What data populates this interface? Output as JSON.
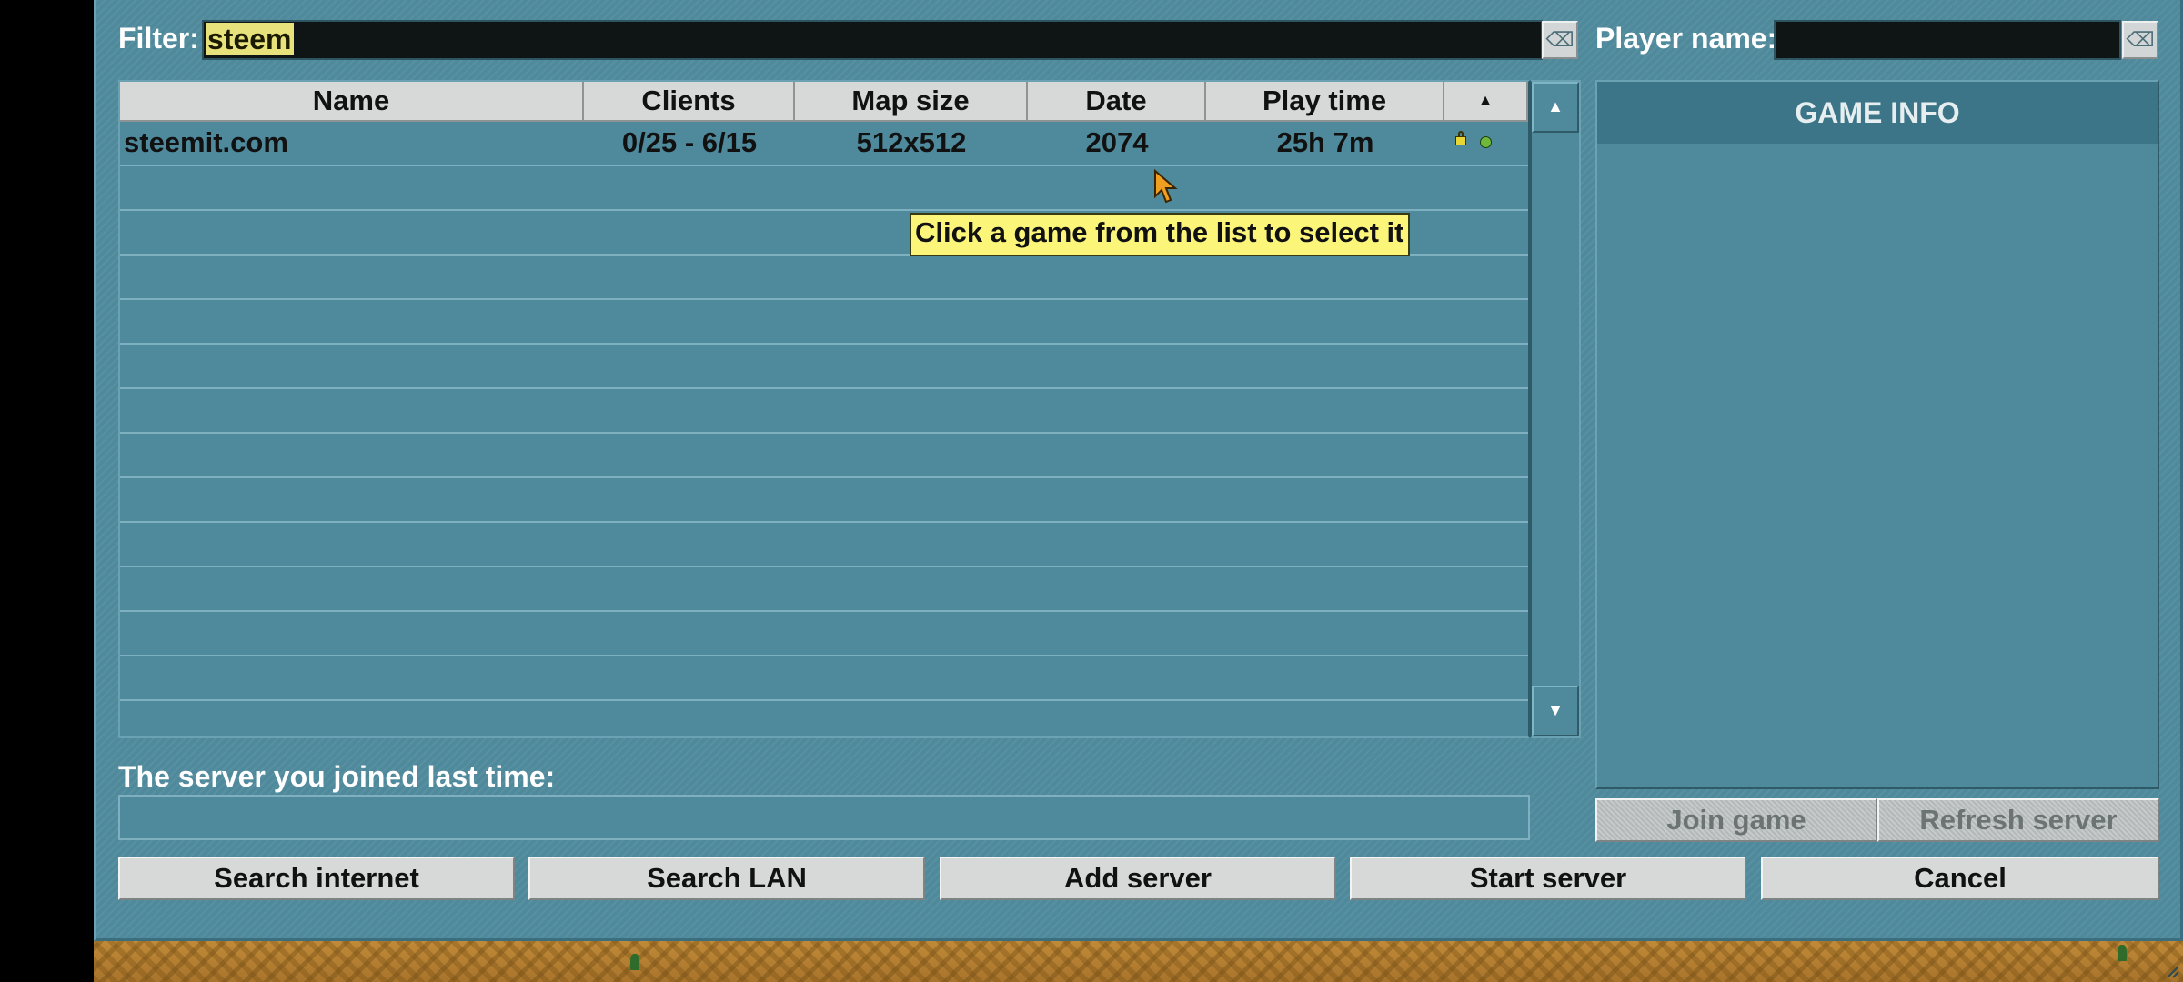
{
  "filter": {
    "label": "Filter:",
    "value": "steem",
    "clear_icon": "⌫"
  },
  "player": {
    "label": "Player name:",
    "value": "",
    "clear_icon": "⌫"
  },
  "table": {
    "columns": [
      "Name",
      "Clients",
      "Map size",
      "Date",
      "Play time"
    ],
    "sort_indicator": "▲",
    "rows": [
      {
        "name": "steemit.com",
        "clients": "0/25 - 6/15",
        "map_size": "512x512",
        "date": "2074",
        "play_time": "25h 7m"
      }
    ]
  },
  "tooltip": "Click a game from the list to select it",
  "scroll": {
    "up": "▲",
    "down": "▼"
  },
  "game_info": {
    "title": "GAME INFO"
  },
  "last_server": {
    "label": "The server you joined last time:",
    "value": ""
  },
  "actions": {
    "join": "Join game",
    "refresh": "Refresh server",
    "search_internet": "Search internet",
    "search_lan": "Search LAN",
    "add_server": "Add server",
    "start_server": "Start server",
    "cancel": "Cancel"
  },
  "colors": {
    "panel": "#4f8a9c",
    "header_bar": "#3c7587",
    "tooltip": "#fbf57a",
    "filter_text": "#f2ec7a",
    "status_online": "#6fb83a",
    "lock": "#e8d636"
  }
}
